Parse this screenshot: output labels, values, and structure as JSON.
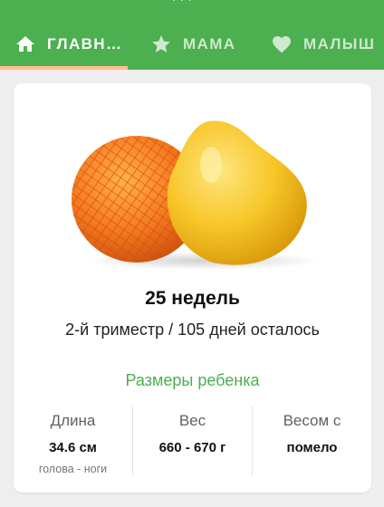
{
  "colors": {
    "app_bar": "#4caf50",
    "tab_indicator": "#ffbe8e",
    "accent_text": "#4caf50"
  },
  "tabs": [
    {
      "label": "ГЛАВН…",
      "icon": "home-icon",
      "active": true
    },
    {
      "label": "МАМА",
      "icon": "star-icon",
      "active": false
    },
    {
      "label": "МАЛЫШ",
      "icon": "heart-icon",
      "active": false
    }
  ],
  "week_card": {
    "image": "pomelo-fruit-image",
    "weeks_label": "25 недель",
    "trimester_label": "2-й триместр / 105 дней осталось",
    "sizes_title": "Размеры ребенка",
    "stats": [
      {
        "label": "Длина",
        "value": "34.6 см",
        "note": "голова - ноги"
      },
      {
        "label": "Вес",
        "value": "660 - 670 г",
        "note": ""
      },
      {
        "label": "Весом с",
        "value": "помело",
        "note": ""
      }
    ]
  }
}
